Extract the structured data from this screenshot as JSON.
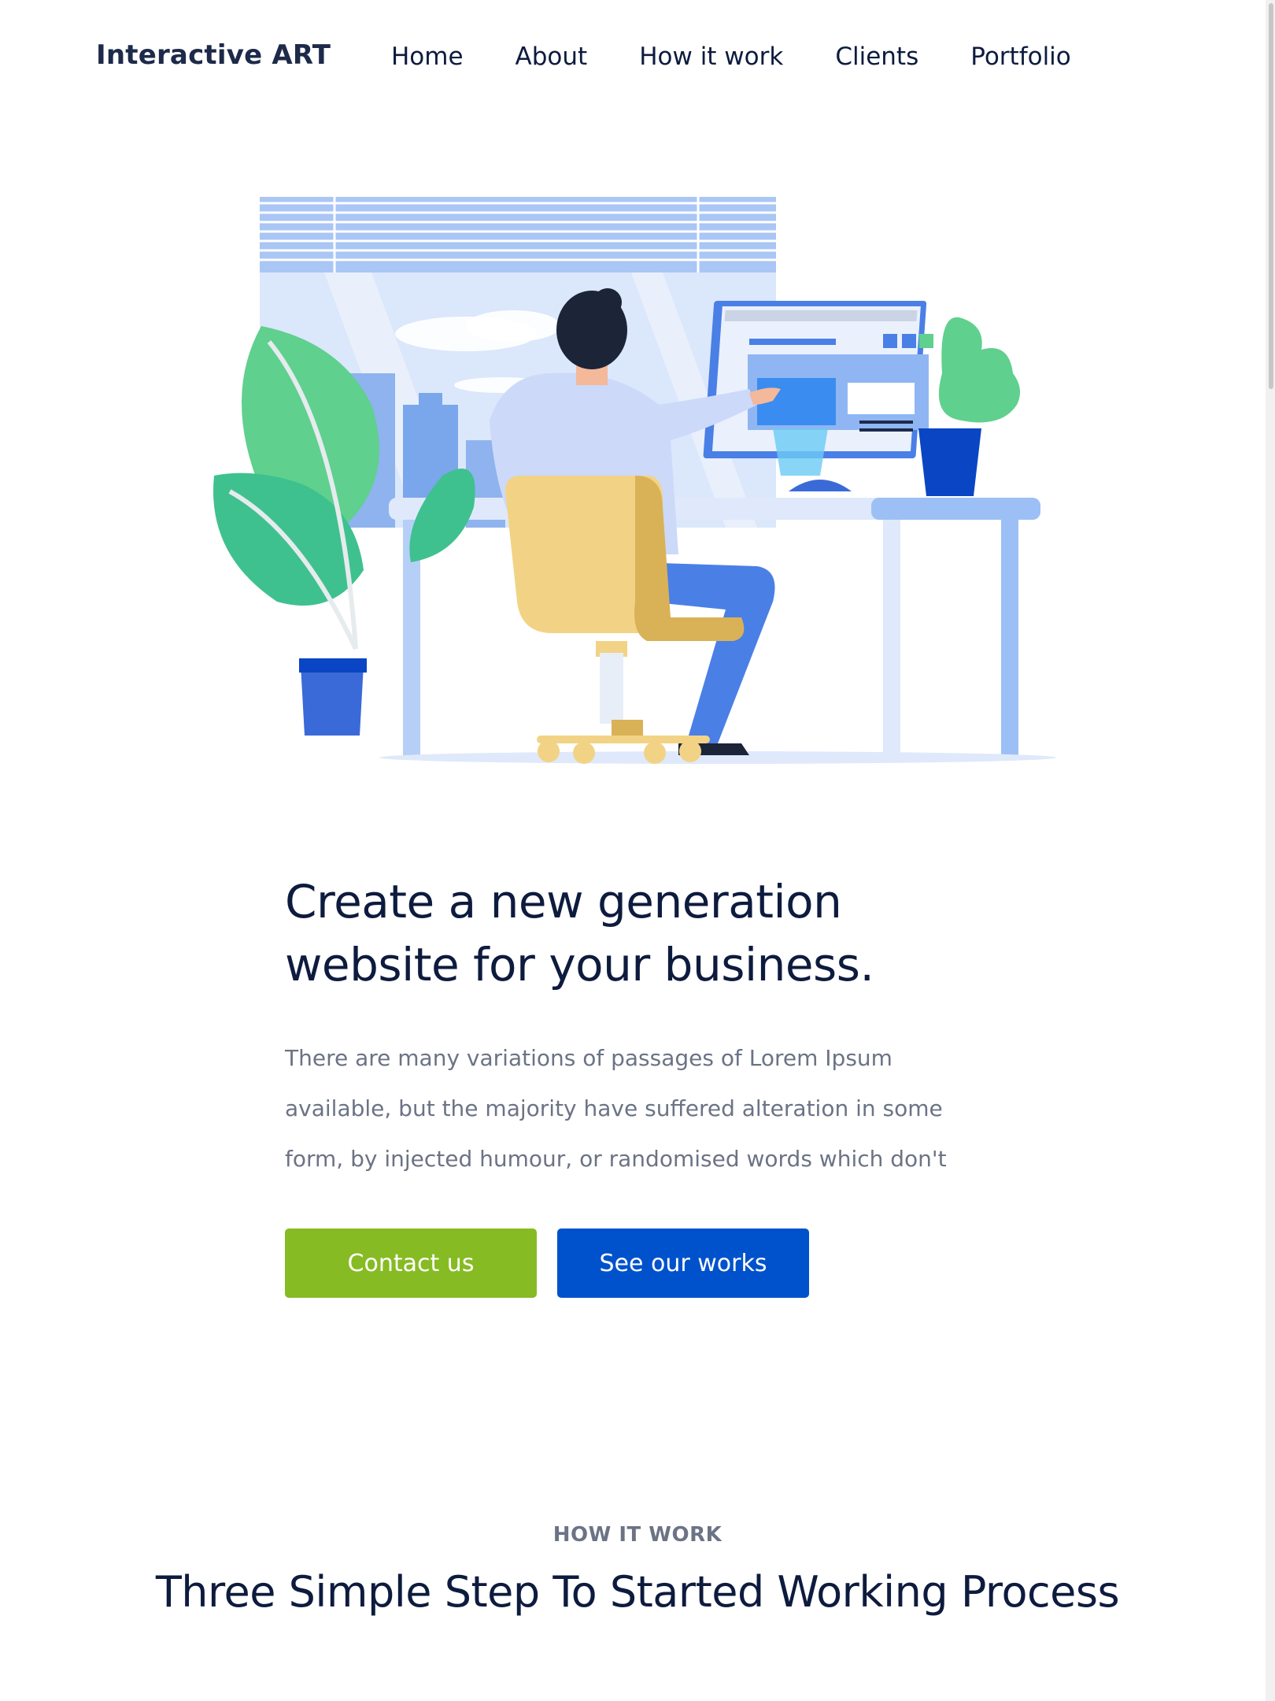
{
  "header": {
    "logo": "Interactive ART",
    "nav": [
      {
        "label": "Home"
      },
      {
        "label": "About"
      },
      {
        "label": "How it work"
      },
      {
        "label": "Clients"
      },
      {
        "label": "Portfolio"
      }
    ]
  },
  "hero": {
    "title_line1": "Create a new generation",
    "title_line2": "website for your business.",
    "text_line1": "There are many variations of passages of Lorem Ipsum",
    "text_line2": "available, but the majority have suffered alteration in some",
    "text_line3": "form, by injected humour, or randomised words which don't",
    "contact_label": "Contact us",
    "works_label": "See our works"
  },
  "how_it_works": {
    "eyebrow": "HOW IT WORK",
    "title": "Three Simple Step To Started Working Process"
  },
  "colors": {
    "primary_green": "#86bb23",
    "primary_blue": "#0052cc",
    "heading": "#0d1b3e",
    "body_text": "#6b7385"
  },
  "illustration": {
    "icon": "person-at-desk-illustration"
  }
}
